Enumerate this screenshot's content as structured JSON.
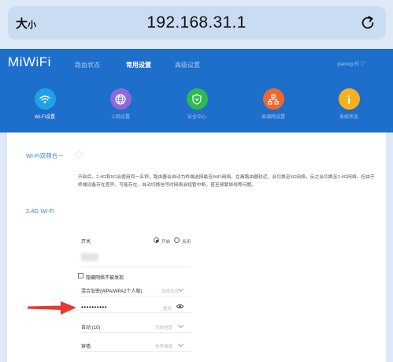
{
  "browser": {
    "text_size_label": "大",
    "text_size_label_small": "小",
    "url": "192.168.31.1",
    "reload_icon": "reload-icon"
  },
  "router": {
    "logo": "MiWiFi",
    "nav": {
      "status": "路由状态",
      "common": "常用设置",
      "advanced": "高级设置"
    },
    "user": "qiaoorg 的 ▽",
    "tiles": [
      {
        "label": "Wi-Fi设置",
        "icon": "wifi-icon",
        "color": "#1fa1e8"
      },
      {
        "label": "上网设置",
        "icon": "globe-icon",
        "color": "#8b6ad8"
      },
      {
        "label": "安全中心",
        "icon": "shield-icon",
        "color": "#2dbb4e"
      },
      {
        "label": "局域网设置",
        "icon": "network-icon",
        "color": "#f06632"
      },
      {
        "label": "系统状态",
        "icon": "info-icon",
        "color": "#f5b21c"
      }
    ]
  },
  "content": {
    "section1_title": "Wi-Fi双频合一",
    "description": "开启后，2.4G和5G会使用同一名称，路由器会自动为终端选择最佳WiFi网络。在离路由器较近，会切换至5G网络，反之会切换至2.4G网络。但由于终端设备存在差异，可能存在，自动切换信号时网络会短暂中断，甚至频繁掉线等问题。",
    "section2_title": "2.4G Wi-Fi",
    "switch": {
      "label": "开关",
      "on": "开启",
      "off": "关闭"
    },
    "hide_network_label": "隐藏网络不被发现",
    "encryption": {
      "label": "混合加密(WPA/WPA2个人版)",
      "hint": "加密方式"
    },
    "password": {
      "value": "••••••••••",
      "hint": "密码"
    },
    "channel": {
      "label": "自动 (10)",
      "hint": "无线信道"
    },
    "signal": {
      "label": "穿墙",
      "hint": "信号强度"
    }
  },
  "colors": {
    "header": "#1e6ecb",
    "accent": "#3c83d6",
    "arrow": "#e53935"
  }
}
